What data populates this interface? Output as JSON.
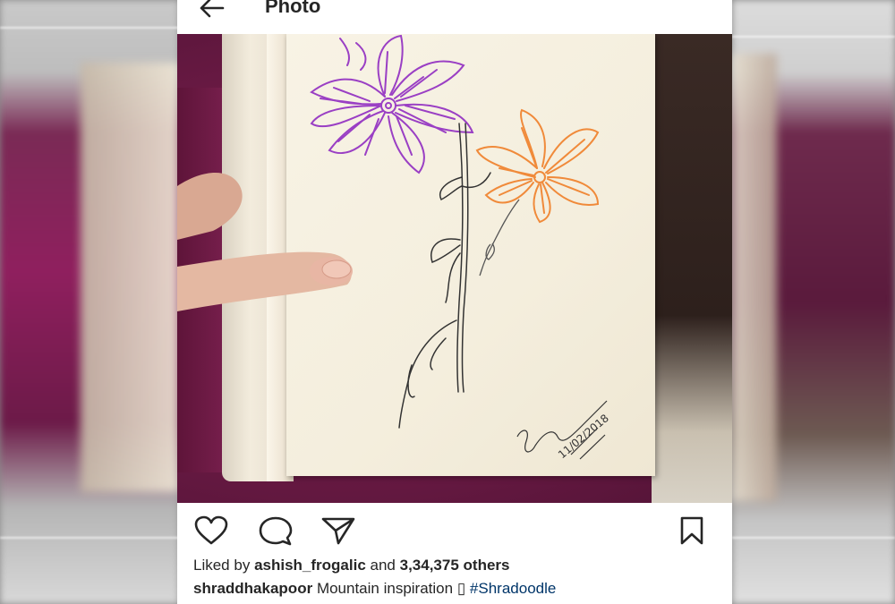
{
  "header": {
    "title": "Photo",
    "back_icon": "arrow-left-icon"
  },
  "post": {
    "image_description_alt": "",
    "signature": "Shraddha Kapoor",
    "signature_date": "11/02/2018",
    "liked_by_prefix": "Liked by",
    "liked_by_user": "ashish_frogalic",
    "liked_and": "and",
    "likes_count": "3,34,375 others",
    "caption_user": "shraddhakapoor",
    "caption_text": "Mountain inspiration",
    "caption_emoji": "▯",
    "caption_hashtag": "#Shradoodle"
  },
  "actions": {
    "like_icon": "heart-icon",
    "comment_icon": "comment-icon",
    "share_icon": "send-icon",
    "save_icon": "bookmark-icon"
  },
  "colors": {
    "text": "#262626",
    "hashtag": "#003569",
    "purple_flower": "#9a3fc4",
    "orange_flower": "#f08a3a"
  }
}
